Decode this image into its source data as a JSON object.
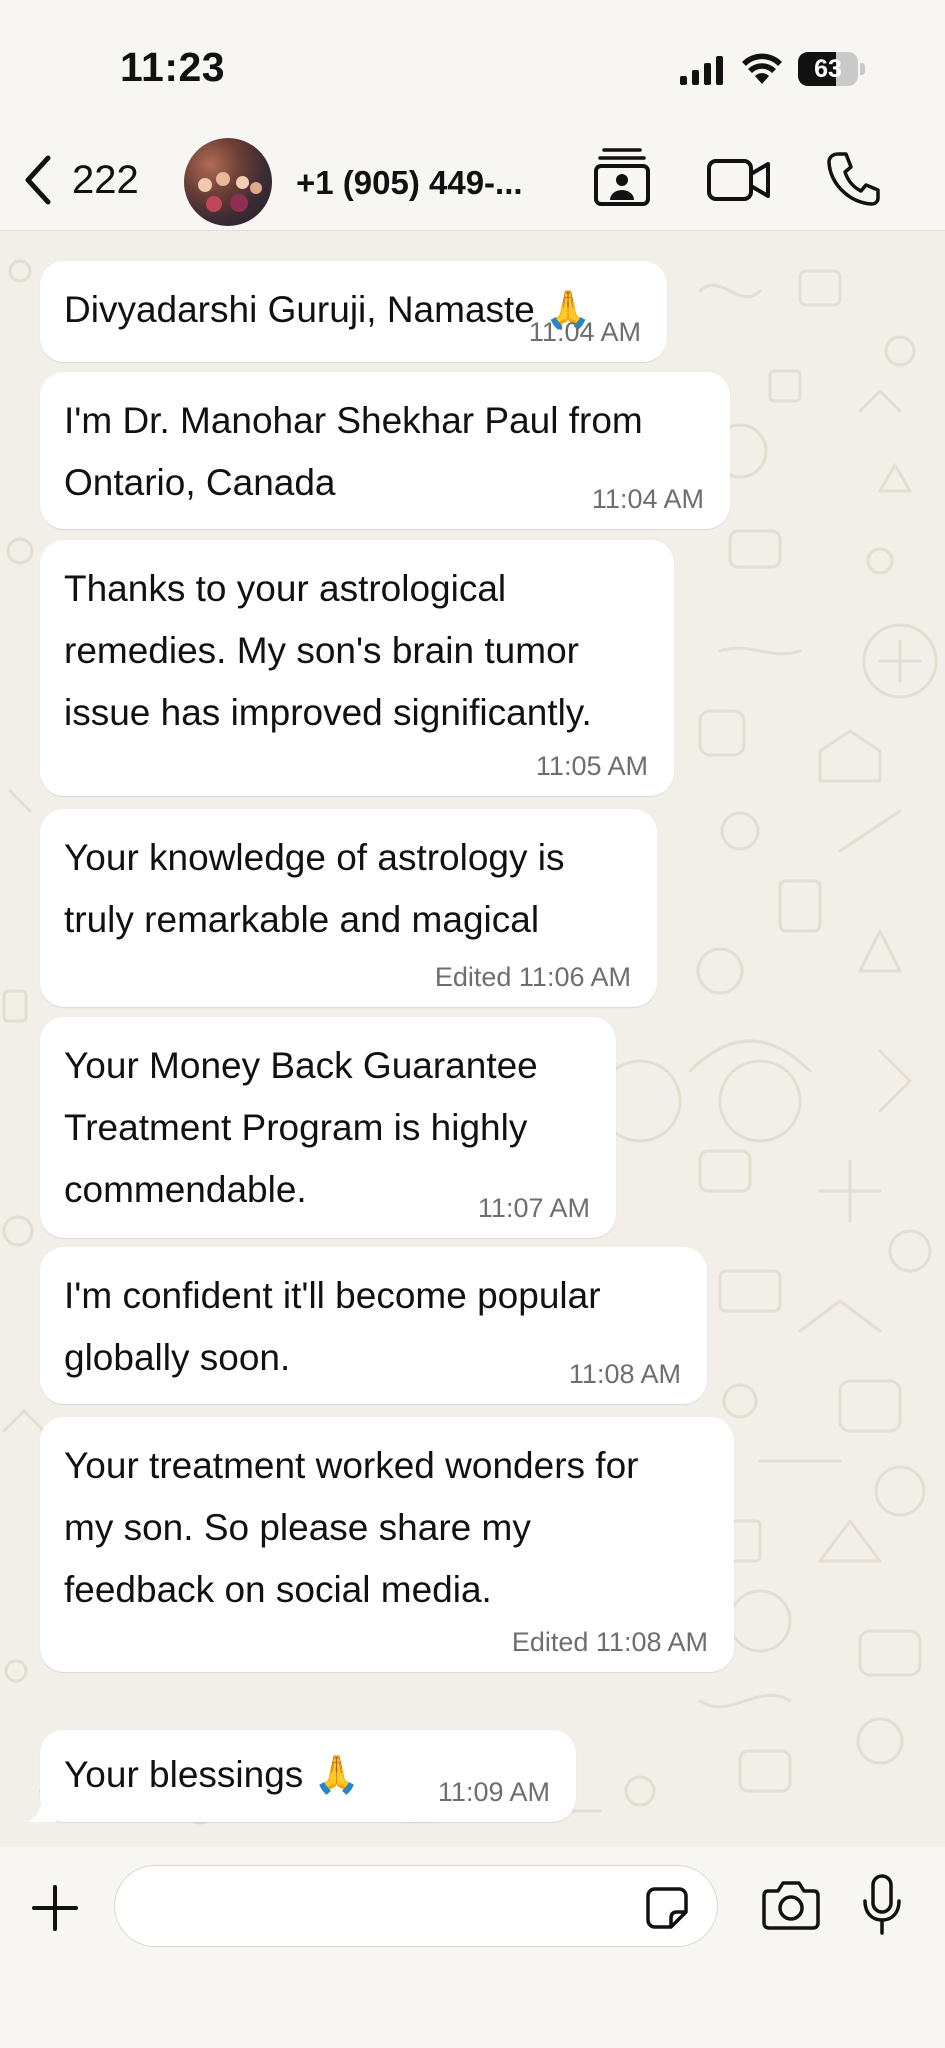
{
  "status_bar": {
    "time": "11:23",
    "battery": "63",
    "battery_level": 0.63
  },
  "header": {
    "back_count": "222",
    "contact_name": "+1 (905) 449-..."
  },
  "messages": [
    {
      "text": "Divyadarshi Guruji, Namaste 🙏",
      "time": "11:04 AM"
    },
    {
      "text": "I'm Dr. Manohar Shekhar Paul from\nOntario, Canada",
      "time": "11:04 AM"
    },
    {
      "text": "Thanks to your astrological\nremedies. My son's brain tumor\nissue has improved significantly.",
      "time": "11:05 AM"
    },
    {
      "text": "Your knowledge of astrology is\ntruly remarkable and magical",
      "time": "Edited  11:06 AM"
    },
    {
      "text": "Your Money Back Guarantee\nTreatment Program is highly\ncommendable.",
      "time": "11:07 AM"
    },
    {
      "text": "I'm confident it'll become popular\nglobally soon.",
      "time": "11:08 AM"
    },
    {
      "text": "Your treatment worked wonders for\nmy son. So please share my\nfeedback on social media.",
      "time": "Edited  11:08 AM"
    },
    {
      "text": "Your blessings 🙏",
      "time": "11:09 AM"
    }
  ],
  "composer": {
    "placeholder": ""
  },
  "icons": {
    "back": "chevron-left-icon",
    "stickers_header": "contact-card-icon",
    "video": "video-camera-icon",
    "call": "phone-icon",
    "attach": "plus-icon",
    "sticker": "sticker-icon",
    "camera": "camera-icon",
    "mic": "microphone-icon"
  },
  "colors": {
    "chat_bg": "#f2efe9",
    "bubble": "#ffffff",
    "timestamp": "#6e6e6e"
  }
}
